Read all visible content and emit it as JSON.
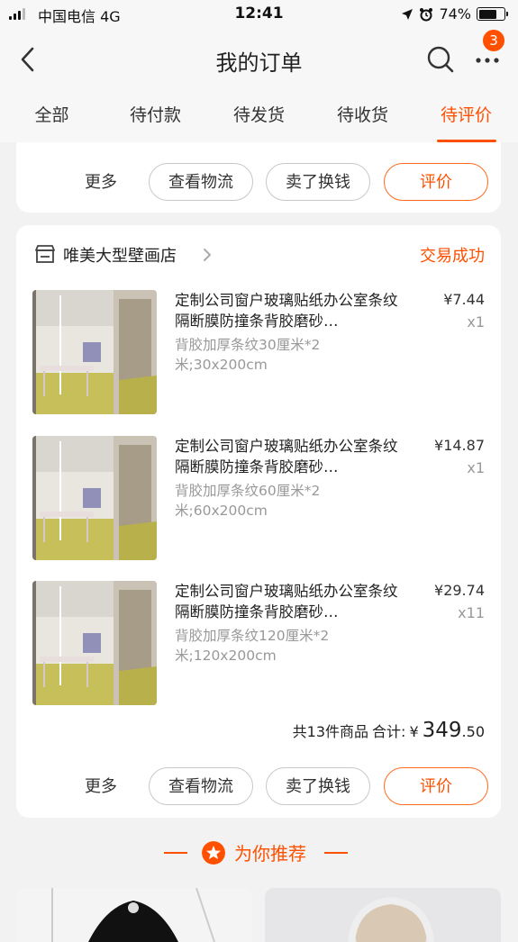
{
  "status_bar": {
    "carrier": "中国电信  4G",
    "time": "12:41",
    "battery": "74%",
    "battery_level": 0.74
  },
  "header": {
    "title": "我的订单",
    "badge_count": "3"
  },
  "tabs": [
    {
      "label": "全部"
    },
    {
      "label": "待付款"
    },
    {
      "label": "待发货"
    },
    {
      "label": "待收货"
    },
    {
      "label": "待评价",
      "active": true
    }
  ],
  "top_card": {
    "more": "更多",
    "logistics": "查看物流",
    "sell": "卖了换钱",
    "review": "评价"
  },
  "order": {
    "store_name": "唯美大型壁画店",
    "status": "交易成功",
    "items": [
      {
        "title": "定制公司窗户玻璃贴纸办公室条纹隔断膜防撞条背胶磨砂…",
        "sku": "背胶加厚条纹30厘米*2米;30x200cm",
        "price": "¥7.44",
        "qty": "x1"
      },
      {
        "title": "定制公司窗户玻璃贴纸办公室条纹隔断膜防撞条背胶磨砂…",
        "sku": "背胶加厚条纹60厘米*2米;60x200cm",
        "price": "¥14.87",
        "qty": "x1"
      },
      {
        "title": "定制公司窗户玻璃贴纸办公室条纹隔断膜防撞条背胶磨砂…",
        "sku": "背胶加厚条纹120厘米*2米;120x200cm",
        "price": "¥29.74",
        "qty": "x11"
      }
    ],
    "total_count": "共13件商品",
    "total_label": "合计:",
    "currency": "¥",
    "total_int": "349",
    "total_dec": ".50",
    "actions": {
      "more": "更多",
      "logistics": "查看物流",
      "sell": "卖了换钱",
      "review": "评价"
    }
  },
  "recommend": {
    "label": "为你推荐"
  },
  "colors": {
    "accent": "#ff5000",
    "background": "#f2f2f2"
  },
  "icons": [
    "back-icon",
    "search-icon",
    "more-icon",
    "store-icon",
    "chevron-right-icon",
    "star-icon"
  ]
}
